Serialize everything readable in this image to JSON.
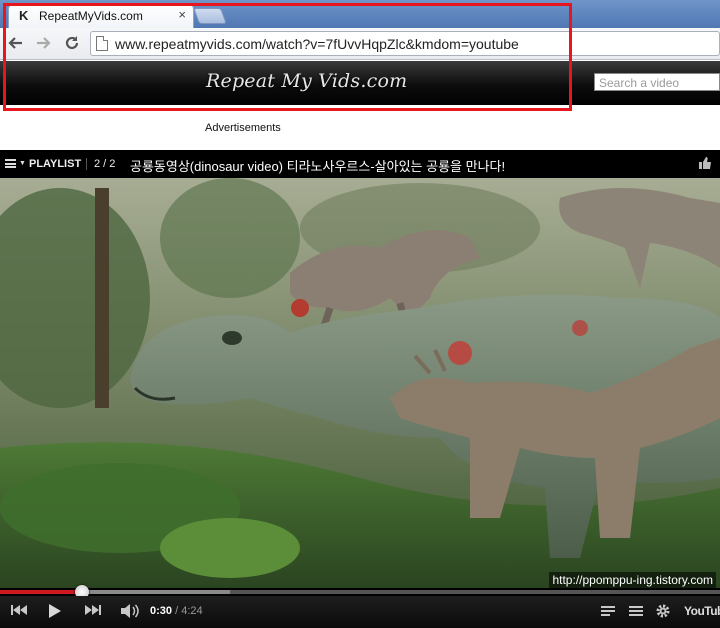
{
  "browser": {
    "tab_title": "RepeatMyVids.com",
    "tab_favicon": "K",
    "tab_close": "×",
    "url": "www.repeatmyvids.com/watch?v=7fUvvHqpZlc&kmdom=youtube",
    "icons": [
      "back-arrow-icon",
      "forward-arrow-icon",
      "reload-icon",
      "page-icon",
      "close-icon"
    ]
  },
  "site": {
    "logo_text": "Repeat My Vids.com",
    "search_placeholder": "Search a video",
    "ads_label": "Advertisements"
  },
  "player": {
    "playlist_label": "PLAYLIST",
    "playlist_count": "2 / 2",
    "video_title": "공룡동영상(dinosaur video) 티라노사우르스-살아있는 공룡을 만나다!",
    "watermark": "http://ppomppu-ing.tistory.com",
    "current_time": "0:30",
    "total_time": "4:24",
    "played_fraction": 0.114,
    "buffered_fraction": 0.32,
    "logo": "YouTube",
    "accent_color": "#cc181e"
  },
  "annotation": {
    "highlight_color": "#e8151d"
  }
}
